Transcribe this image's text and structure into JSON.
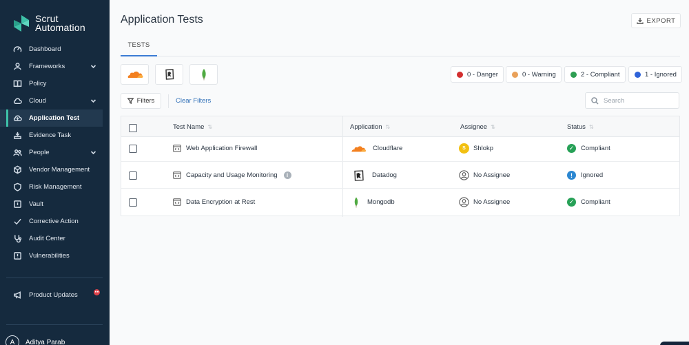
{
  "sidebar": {
    "logo": {
      "line1": "Scrut",
      "line2": "Automation",
      "color": "#3ec1a8"
    },
    "items": [
      {
        "label": "Dashboard",
        "icon": "dashboard-icon",
        "chevron": false
      },
      {
        "label": "Frameworks",
        "icon": "frameworks-icon",
        "chevron": true
      },
      {
        "label": "Policy",
        "icon": "book-icon",
        "chevron": false
      },
      {
        "label": "Cloud",
        "icon": "cloud-icon",
        "chevron": true
      },
      {
        "label": "Application Test",
        "icon": "cloud-upload-icon",
        "chevron": false,
        "active": true
      },
      {
        "label": "Evidence Task",
        "icon": "evidence-icon",
        "chevron": false
      },
      {
        "label": "People",
        "icon": "people-icon",
        "chevron": true
      },
      {
        "label": "Vendor Management",
        "icon": "cube-icon",
        "chevron": false
      },
      {
        "label": "Risk Management",
        "icon": "shield-icon",
        "chevron": false
      },
      {
        "label": "Vault",
        "icon": "vault-icon",
        "chevron": false
      },
      {
        "label": "Corrective Action",
        "icon": "check-icon",
        "chevron": false
      },
      {
        "label": "Audit Center",
        "icon": "stethoscope-icon",
        "chevron": false
      },
      {
        "label": "Vulnerabilities",
        "icon": "alert-icon",
        "chevron": false
      }
    ],
    "product_updates": {
      "label": "Product Updates",
      "icon": "megaphone-icon"
    },
    "user": {
      "initial": "A",
      "name": "Aditya Parab"
    }
  },
  "header": {
    "title": "Application Tests",
    "export_label": "EXPORT"
  },
  "tabs": [
    {
      "label": "TESTS",
      "active": true
    }
  ],
  "app_filters": [
    {
      "name": "cloudflare",
      "icon": "cloudflare-logo-icon"
    },
    {
      "name": "datadog",
      "icon": "datadog-logo-icon"
    },
    {
      "name": "mongodb",
      "icon": "mongodb-leaf-icon"
    }
  ],
  "legend": [
    {
      "label": "0 - Danger",
      "color": "#d32f2f"
    },
    {
      "label": "0 - Warning",
      "color": "#e9a15a"
    },
    {
      "label": "2 - Compliant",
      "color": "#2e9e52"
    },
    {
      "label": "1 - Ignored",
      "color": "#2f63d9"
    }
  ],
  "filters": {
    "filters_label": "Filters",
    "clear_label": "Clear Filters",
    "search_placeholder": "Search"
  },
  "table": {
    "columns": [
      "Test Name",
      "Application",
      "Assignee",
      "Status"
    ],
    "rows": [
      {
        "test": "Web Application Firewall",
        "app": "Cloudflare",
        "app_icon": "cloudflare-logo-icon",
        "assignee": "Shlokp",
        "assignee_initial": "S",
        "status": "Compliant",
        "status_type": "compliant",
        "info": false
      },
      {
        "test": "Capacity and Usage Monitoring",
        "app": "Datadog",
        "app_icon": "datadog-logo-icon",
        "assignee": "No Assignee",
        "assignee_initial": "",
        "status": "Ignored",
        "status_type": "ignored",
        "info": true
      },
      {
        "test": "Data Encryption at Rest",
        "app": "Mongodb",
        "app_icon": "mongodb-leaf-icon",
        "assignee": "No Assignee",
        "assignee_initial": "",
        "status": "Compliant",
        "status_type": "compliant",
        "info": false
      }
    ]
  }
}
